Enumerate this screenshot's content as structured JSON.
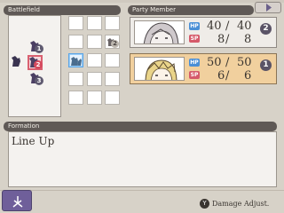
{
  "battlefield": {
    "title": "Battlefield",
    "unit_markers": [
      "1",
      "2",
      "3"
    ],
    "grid_marker": "2"
  },
  "party": {
    "title": "Party Member",
    "members": [
      {
        "hp_label": "HP",
        "hp": "40",
        "hp_max": "40",
        "sp_label": "SP",
        "sp": "8",
        "sp_max": "8",
        "slot": "2"
      },
      {
        "hp_label": "HP",
        "hp": "50",
        "hp_max": "50",
        "sp_label": "SP",
        "sp": "6",
        "sp_max": "6",
        "slot": "1"
      }
    ]
  },
  "formation": {
    "title": "Formation",
    "value": "Line Up"
  },
  "footer": {
    "hint_button": "Y",
    "hint_label": "Damage Adjust."
  },
  "colors": {
    "selected_card": "#f1d09e",
    "hp_badge": "#4a8fd6",
    "sp_badge": "#d55a6a"
  },
  "icons": [
    "right-arrow-icon",
    "menu-icon",
    "knight-piece-icon"
  ]
}
